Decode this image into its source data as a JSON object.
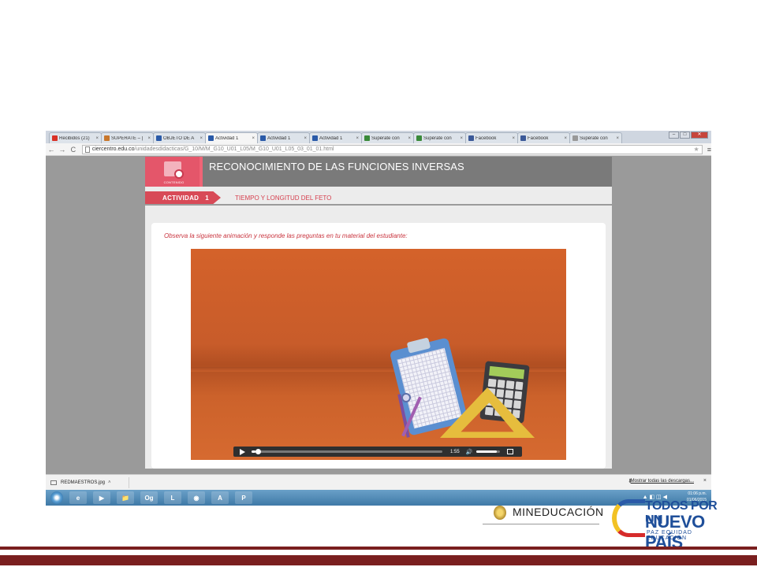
{
  "browser": {
    "tabs": [
      {
        "label": "Recibidos (21)",
        "icon": "gmail-icon",
        "color": "#d93025"
      },
      {
        "label": "SUPERATE – |",
        "icon": "page-icon",
        "color": "#c8772c"
      },
      {
        "label": "OBJETO DE A",
        "icon": "grid-icon",
        "color": "#2a5aa8"
      },
      {
        "label": "Actividad 1",
        "icon": "grid-icon",
        "color": "#2a5aa8",
        "active": true
      },
      {
        "label": "Actividad 1",
        "icon": "grid-icon",
        "color": "#2a5aa8"
      },
      {
        "label": "Actividad 1",
        "icon": "grid-icon",
        "color": "#2a5aa8"
      },
      {
        "label": "Supérate con",
        "icon": "leaf-icon",
        "color": "#3a8a3a"
      },
      {
        "label": "Supérate con",
        "icon": "leaf-icon",
        "color": "#3a8a3a"
      },
      {
        "label": "Facebook",
        "icon": "facebook-icon",
        "color": "#3b5998"
      },
      {
        "label": "Facebook",
        "icon": "facebook-icon",
        "color": "#3b5998"
      },
      {
        "label": "Supérate con",
        "icon": "page-icon",
        "color": "#999999"
      }
    ],
    "tab_close": "×",
    "window_controls": {
      "minimize": "–",
      "maximize": "□",
      "close": "✕"
    },
    "nav": {
      "back": "←",
      "forward": "→",
      "reload": "C"
    },
    "url_host": "ciercentro.edu.co",
    "url_path": "/unidadesdidacticas/G_10/M/M_G10_U01_L05/M_G10_U01_L05_03_01_01.html",
    "bookmark_star": "★",
    "menu": "≡"
  },
  "page": {
    "badge_label": "CONTENIDO",
    "title": "RECONOCIMIENTO DE LAS FUNCIONES INVERSAS",
    "activity_label": "ACTIVIDAD",
    "activity_number": "1",
    "activity_title": "TIEMPO Y LONGITUD DEL FETO",
    "instruction": "Observa la siguiente animación y responde las preguntas en tu material del estudiante:",
    "video": {
      "time": "1:55",
      "progress": 0.02,
      "volume": 0.85,
      "speaker_icon": "🔊"
    }
  },
  "downloads": {
    "file": "REDMAESTROS.jpg",
    "caret": "˄",
    "show_all_icon": "⬇",
    "show_all": "Mostrar todas las descargas...",
    "close": "×"
  },
  "taskbar": {
    "apps": [
      "e",
      "▶",
      "📁",
      "Og",
      "L",
      "◉",
      "A",
      "P"
    ],
    "tray_icons": "▲ ◧ ◫ ◀",
    "time": "01:06 p.m.",
    "date": "01/06/2015"
  },
  "logos": {
    "mineducacion": "MINEDUCACIÓN",
    "tpn_line1": "TODOS POR UN",
    "tpn_line2": "NUEVO PAÍS",
    "tpn_line3": "PAZ  EQUIDAD  EDUCACIÓN"
  }
}
